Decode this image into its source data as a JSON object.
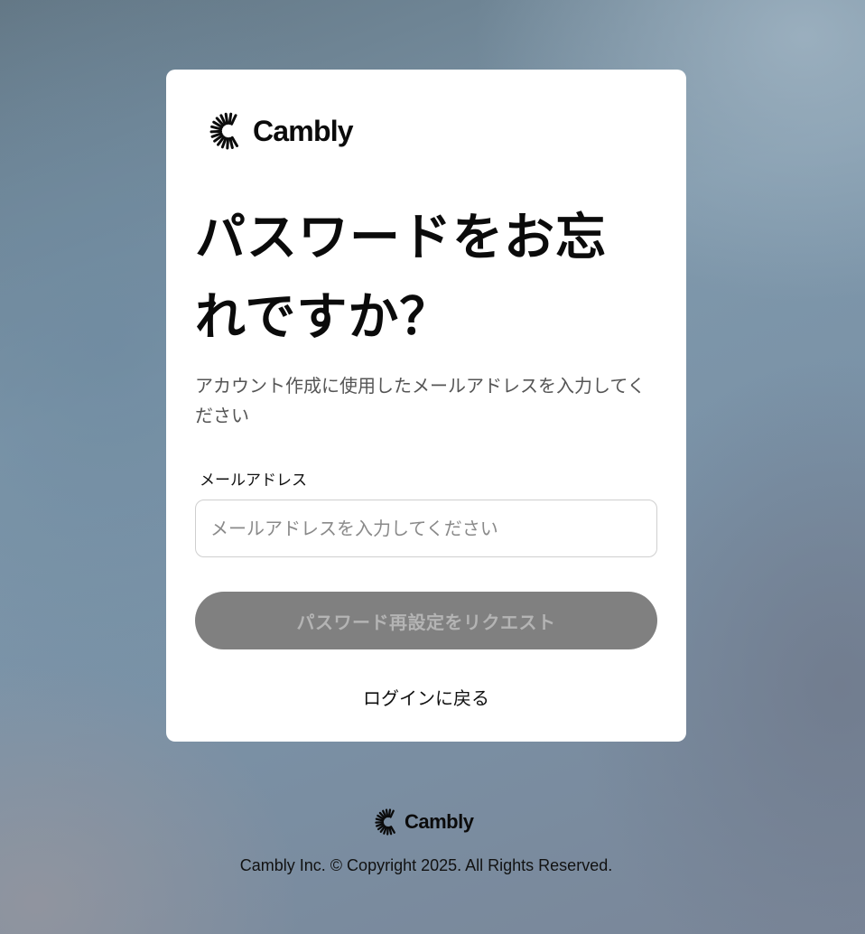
{
  "brand": {
    "name": "Cambly",
    "logo_icon": "cambly-sunburst-icon"
  },
  "form": {
    "title": "パスワードをお忘れですか？",
    "subtitle": "アカウント作成に使用したメールアドレスを入力してください",
    "email_label": "メールアドレス",
    "email_value": "",
    "email_placeholder": "メールアドレスを入力してください",
    "submit_label": "パスワード再設定をリクエスト",
    "back_link": "ログインに戻る"
  },
  "footer": {
    "brand_name": "Cambly",
    "copyright": "Cambly Inc. © Copyright 2025. All Rights Reserved."
  },
  "colors": {
    "button_disabled_bg": "#808080",
    "button_disabled_text": "#b4b4b4",
    "text_primary": "#0b0b0b",
    "text_secondary": "#555555"
  }
}
